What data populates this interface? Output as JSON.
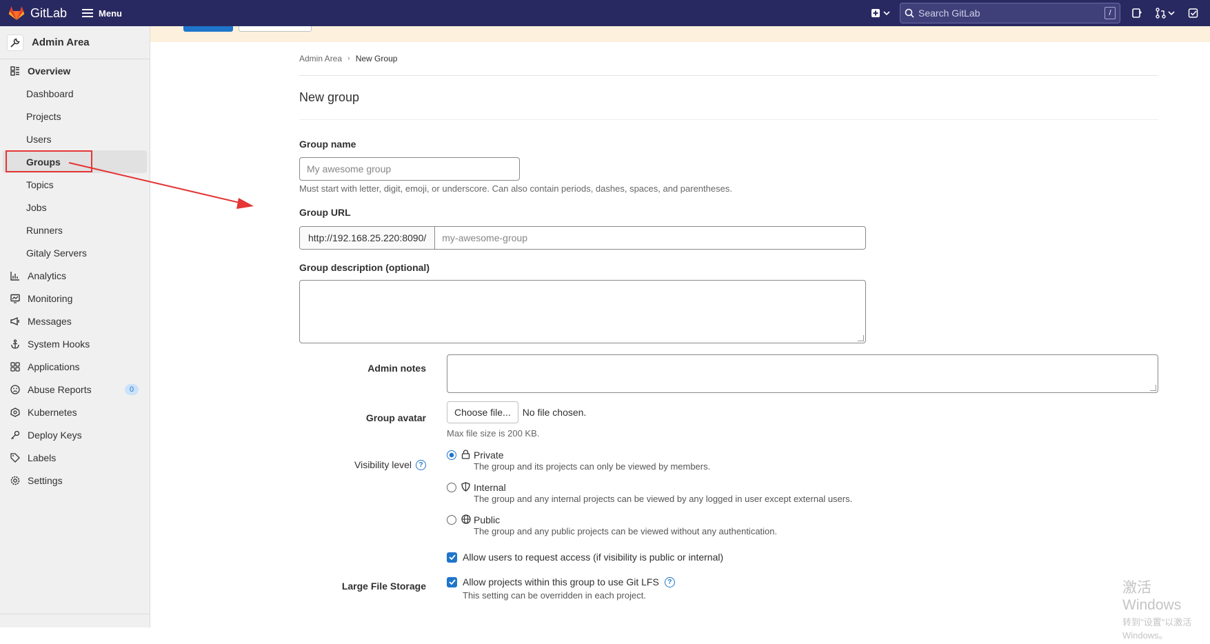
{
  "topbar": {
    "brand": "GitLab",
    "menu_label": "Menu",
    "search_placeholder": "Search GitLab",
    "search_shortcut": "/"
  },
  "sidebar": {
    "header": "Admin Area",
    "items": [
      {
        "label": "Overview",
        "icon": "overview-icon",
        "level": "section"
      },
      {
        "label": "Dashboard",
        "level": "sub"
      },
      {
        "label": "Projects",
        "level": "sub"
      },
      {
        "label": "Users",
        "level": "sub"
      },
      {
        "label": "Groups",
        "level": "sub",
        "active": true
      },
      {
        "label": "Topics",
        "level": "sub"
      },
      {
        "label": "Jobs",
        "level": "sub"
      },
      {
        "label": "Runners",
        "level": "sub"
      },
      {
        "label": "Gitaly Servers",
        "level": "sub"
      },
      {
        "label": "Analytics",
        "icon": "analytics-icon"
      },
      {
        "label": "Monitoring",
        "icon": "monitoring-icon"
      },
      {
        "label": "Messages",
        "icon": "messages-icon"
      },
      {
        "label": "System Hooks",
        "icon": "hooks-icon"
      },
      {
        "label": "Applications",
        "icon": "applications-icon"
      },
      {
        "label": "Abuse Reports",
        "icon": "abuse-icon",
        "badge": "0"
      },
      {
        "label": "Kubernetes",
        "icon": "kubernetes-icon"
      },
      {
        "label": "Deploy Keys",
        "icon": "key-icon"
      },
      {
        "label": "Labels",
        "icon": "label-icon"
      },
      {
        "label": "Settings",
        "icon": "settings-icon"
      }
    ]
  },
  "breadcrumb": {
    "root": "Admin Area",
    "current": "New Group"
  },
  "page_title": "New group",
  "form": {
    "group_name_label": "Group name",
    "group_name_placeholder": "My awesome group",
    "group_name_help": "Must start with letter, digit, emoji, or underscore. Can also contain periods, dashes, spaces, and parentheses.",
    "group_url_label": "Group URL",
    "group_url_prefix": "http://192.168.25.220:8090/",
    "group_url_placeholder": "my-awesome-group",
    "description_label": "Group description (optional)",
    "admin_notes_label": "Admin notes",
    "avatar_label": "Group avatar",
    "choose_file": "Choose file...",
    "no_file": "No file chosen.",
    "max_size": "Max file size is 200 KB.",
    "visibility_label": "Visibility level",
    "visibility_options": [
      {
        "title": "Private",
        "desc": "The group and its projects can only be viewed by members.",
        "selected": true
      },
      {
        "title": "Internal",
        "desc": "The group and any internal projects can be viewed by any logged in user except external users.",
        "selected": false
      },
      {
        "title": "Public",
        "desc": "The group and any public projects can be viewed without any authentication.",
        "selected": false
      }
    ],
    "request_access_label": "Allow users to request access (if visibility is public or internal)",
    "lfs_row_label": "Large File Storage",
    "lfs_label": "Allow projects within this group to use Git LFS",
    "lfs_help": "This setting can be overridden in each project."
  },
  "watermark": {
    "line1": "激活 Windows",
    "line2": "转到\"设置\"以激活 Windows。"
  },
  "colors": {
    "navbar": "#292961",
    "accent": "#1f75cb",
    "annotation": "#e53535"
  }
}
